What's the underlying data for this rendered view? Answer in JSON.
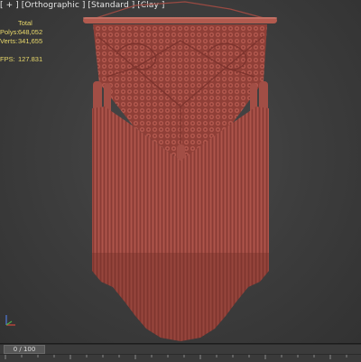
{
  "viewport": {
    "label": "[ + ] [Orthographic ] [Standard ] [Clay ]"
  },
  "stats": {
    "total_label": "Total",
    "polys_label": "Polys:",
    "polys_value": "648,052",
    "verts_label": "Verts:",
    "verts_value": "341,655",
    "fps_label": "FPS:",
    "fps_value": "127.831"
  },
  "timeline": {
    "frame_readout": "0 / 100"
  },
  "colors": {
    "background": "#3e3e3e",
    "rope": "#a85249",
    "dowel": "#b25a4e",
    "stats_text": "#e8d86a"
  },
  "icons": {
    "axis": "xyz-axis-gizmo-icon"
  }
}
